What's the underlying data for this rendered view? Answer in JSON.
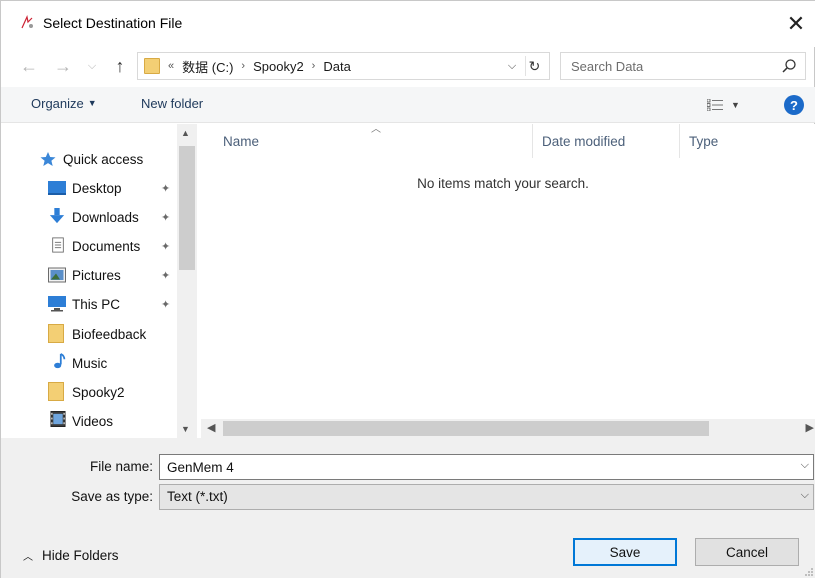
{
  "window": {
    "title": "Select Destination File"
  },
  "nav": {
    "breadcrumbs": [
      "«",
      "数据 (C:)",
      "›",
      "Spooky2",
      "›",
      "Data"
    ],
    "search_placeholder": "Search Data"
  },
  "toolbar": {
    "organize_label": "Organize",
    "new_folder_label": "New folder"
  },
  "sidebar": {
    "items": [
      {
        "label": "Quick access",
        "icon": "star-icon",
        "pinned": false
      },
      {
        "label": "Desktop",
        "icon": "desktop-icon",
        "pinned": true
      },
      {
        "label": "Downloads",
        "icon": "download-icon",
        "pinned": true
      },
      {
        "label": "Documents",
        "icon": "document-icon",
        "pinned": true
      },
      {
        "label": "Pictures",
        "icon": "pictures-icon",
        "pinned": true
      },
      {
        "label": "This PC",
        "icon": "computer-icon",
        "pinned": true
      },
      {
        "label": "Biofeedback",
        "icon": "folder-icon",
        "pinned": false
      },
      {
        "label": "Music",
        "icon": "music-icon",
        "pinned": false
      },
      {
        "label": "Spooky2",
        "icon": "folder-icon",
        "pinned": false
      },
      {
        "label": "Videos",
        "icon": "video-icon",
        "pinned": false
      }
    ]
  },
  "content": {
    "columns": [
      "Name",
      "Date modified",
      "Type"
    ],
    "empty_message": "No items match your search."
  },
  "form": {
    "file_name_label": "File name:",
    "file_name_value": "GenMem 4",
    "save_type_label": "Save as type:",
    "save_type_value": "Text (*.txt)"
  },
  "footer": {
    "hide_folders_label": "Hide Folders",
    "save_label": "Save",
    "cancel_label": "Cancel"
  },
  "colors": {
    "accent": "#0078d7",
    "link": "#1e395b",
    "folder": "#f3cf74",
    "help": "#1b6ac9"
  }
}
